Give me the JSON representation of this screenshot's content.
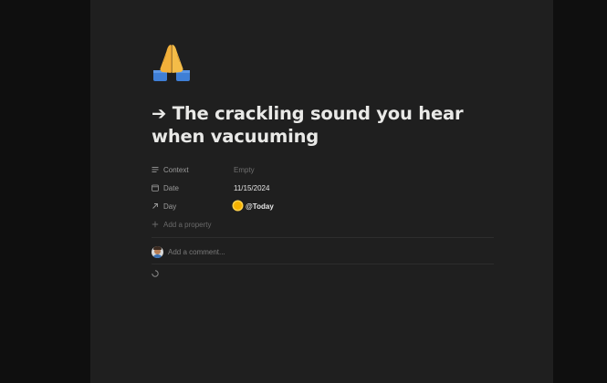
{
  "page": {
    "icon": "folded-hands-icon",
    "title": "➔ The crackling sound you hear when vacuuming"
  },
  "properties": [
    {
      "label": "Context",
      "icon": "text-lines-icon",
      "value": "Empty"
    },
    {
      "label": "Date",
      "icon": "calendar-icon",
      "value": "11/15/2024"
    },
    {
      "label": "Day",
      "icon": "arrow-up-right-icon",
      "value": "@Today",
      "value_icon": "sun-icon"
    }
  ],
  "add_property_label": "Add a property",
  "comment": {
    "placeholder": "Add a comment..."
  },
  "colors": {
    "page_background": "#1f1f1f",
    "side_background": "#0f0f0f",
    "title_text": "#e9e9e7",
    "muted_text": "#9b9b9b"
  }
}
